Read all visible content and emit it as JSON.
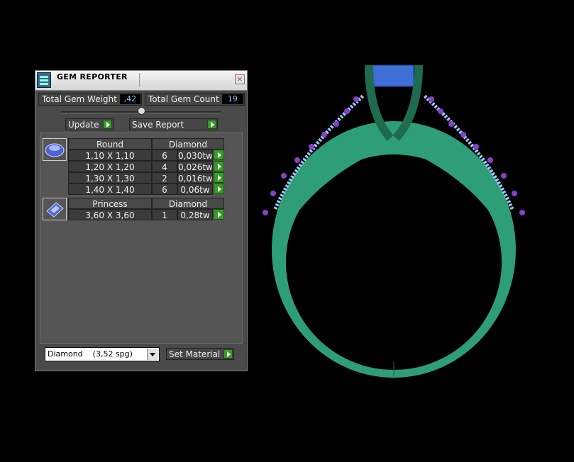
{
  "window": {
    "title": "GEM REPORTER",
    "close_glyph": "×"
  },
  "totals": {
    "weight_label": "Total Gem Weight",
    "weight_value": ",42",
    "count_label": "Total Gem Count",
    "count_value": "19"
  },
  "buttons": {
    "update": "Update",
    "save_report": "Save Report",
    "set_material": "Set Material"
  },
  "groups": [
    {
      "icon": "round-gem-icon",
      "shape": "Round",
      "material": "Diamond",
      "rows": [
        {
          "size": "1,10 X 1,10",
          "count": "6",
          "weight": "0,030tw"
        },
        {
          "size": "1,20 X 1,20",
          "count": "4",
          "weight": "0,026tw"
        },
        {
          "size": "1,30 X 1,30",
          "count": "2",
          "weight": "0,016tw"
        },
        {
          "size": "1,40 X 1,40",
          "count": "6",
          "weight": "0,06tw"
        }
      ]
    },
    {
      "icon": "princess-gem-icon",
      "shape": "Princess",
      "material": "Diamond",
      "rows": [
        {
          "size": "3,60 X 3,60",
          "count": "1",
          "weight": "0,28tw"
        }
      ]
    }
  ],
  "material_select": {
    "value": "Diamond    (3,52 spg)"
  },
  "colors": {
    "ring_metal": "#2e9e78",
    "prongs": "#1f6b4f",
    "center_stone": "#3f6fd6",
    "side_stones": "#8a3fc9",
    "pave_channel": "#9fc7ff",
    "go_button": "#3a9a2a",
    "value_text": "#8ec5ff"
  }
}
